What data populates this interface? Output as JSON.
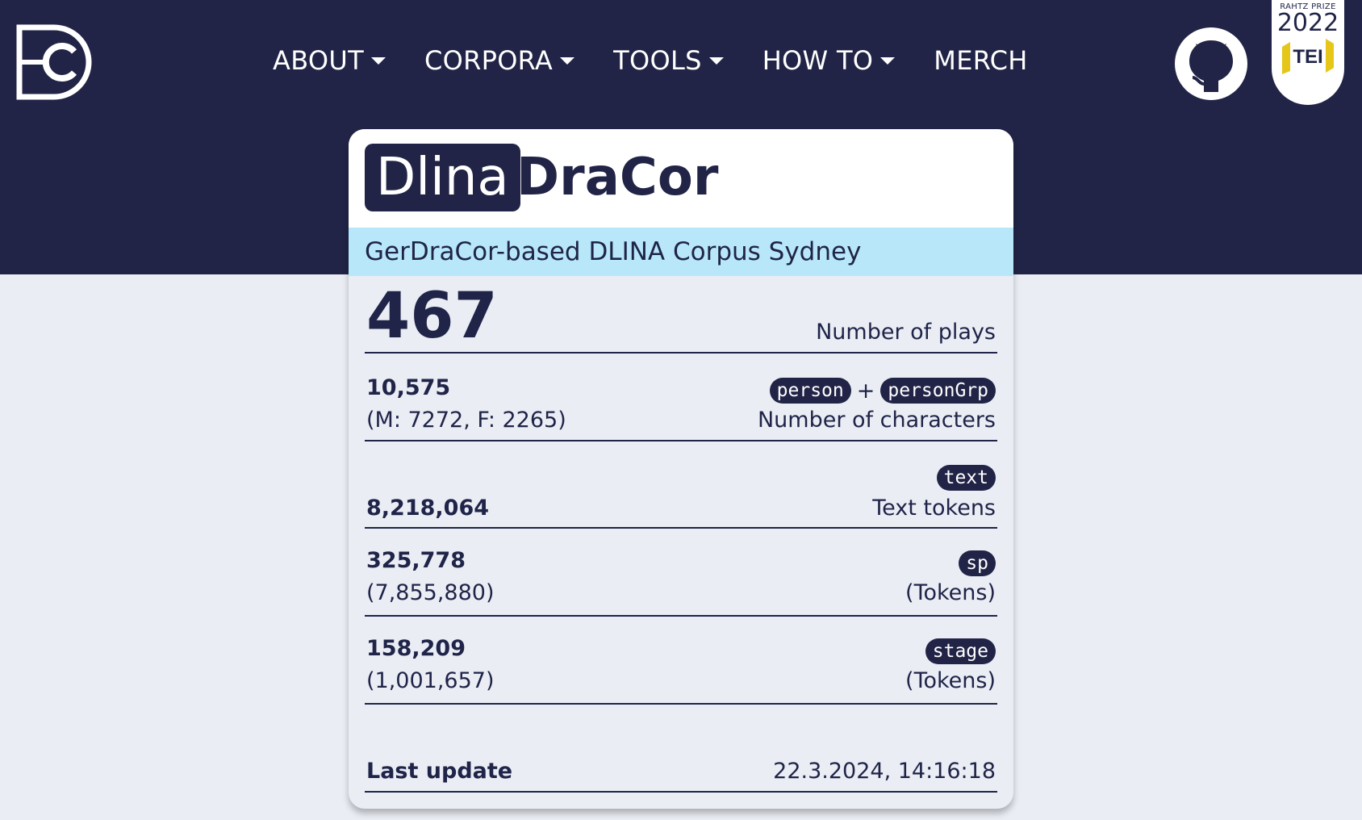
{
  "nav": {
    "items": [
      {
        "label": "ABOUT",
        "dropdown": true
      },
      {
        "label": "CORPORA",
        "dropdown": true
      },
      {
        "label": "TOOLS",
        "dropdown": true
      },
      {
        "label": "HOW TO",
        "dropdown": true
      },
      {
        "label": "MERCH",
        "dropdown": false
      }
    ]
  },
  "prize": {
    "title": "RAHTZ PRIZE",
    "year": "2022",
    "tei": "TEI"
  },
  "card": {
    "brand_prefix": "Dlina",
    "brand_suffix": "DraCor",
    "subtitle": "GerDraCor-based DLINA Corpus Sydney",
    "plays": {
      "value": "467",
      "label": "Number of plays"
    },
    "characters": {
      "value": "10,575",
      "breakdown": "(M: 7272, F: 2265)",
      "label": "Number of characters",
      "tag1": "person",
      "plus": "+",
      "tag2": "personGrp"
    },
    "text": {
      "tag": "text",
      "value": "8,218,064",
      "label": "Text tokens"
    },
    "sp": {
      "tag": "sp",
      "value": "325,778",
      "sub": "(7,855,880)",
      "label": "(Tokens)"
    },
    "stage": {
      "tag": "stage",
      "value": "158,209",
      "sub": "(1,001,657)",
      "label": "(Tokens)"
    },
    "last_update": {
      "label": "Last update",
      "value": "22.3.2024, 14:16:18"
    }
  },
  "colors": {
    "navy": "#212446",
    "subtitle_bg": "#b7e7f9",
    "page_bg": "#eaedf4",
    "tei_gold": "#e6c619"
  },
  "icons": [
    "dracor-logo-icon",
    "github-icon",
    "tei-logo-icon",
    "caret-down-icon"
  ]
}
